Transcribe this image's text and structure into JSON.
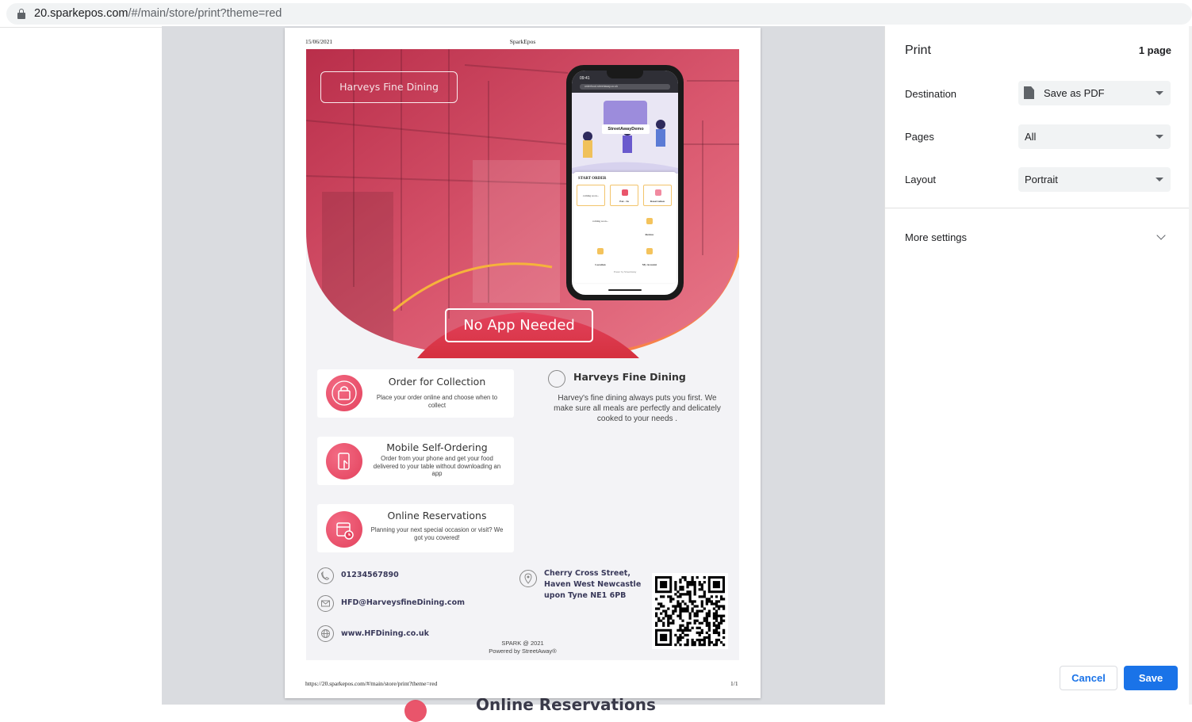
{
  "browser": {
    "url_host": "20.sparkepos.com",
    "url_path": "/#/main/store/print?theme=red"
  },
  "page_header": {
    "date": "15/06/2021",
    "site": "SparkEpos"
  },
  "page_footer": {
    "url": "https://20.sparkepos.com/#/main/store/print?theme=red",
    "page_count": "1/1"
  },
  "flyer": {
    "brand": "Harveys Fine Dining",
    "tagline": "No App Needed",
    "phone_screen": {
      "time": "09:41",
      "address": "orderfood.streetaway.co.uk",
      "store_label": "StreetAwayDemo",
      "start_order": "START ORDER",
      "tiles": [
        "coming soon...",
        "Eat - In",
        "Reservation"
      ],
      "grid": [
        "coming soon...",
        "Review",
        "Location",
        "My Account"
      ],
      "powered": "Power by StreetAway"
    },
    "features": [
      {
        "title": "Order for Collection",
        "desc": "Place your order online and choose when to collect"
      },
      {
        "title": "Mobile Self-Ordering",
        "desc": "Order from your phone and get your food delivered to your table without downloading an app"
      },
      {
        "title": "Online Reservations",
        "desc": "Planning your next special occasion or visit? We got you covered!"
      }
    ],
    "restaurant": {
      "name": "Harveys Fine Dining",
      "description": "Harvey's fine dining always puts you first. We make sure all meals are perfectly and delicately cooked to your needs ."
    },
    "contacts": {
      "phone": "01234567890",
      "email": "HFD@HarveysfineDining.com",
      "website": "www.HFDining.co.uk"
    },
    "address": [
      "Cherry Cross Street,",
      "Haven West Newcastle",
      "upon Tyne NE1 6PB"
    ],
    "footer_line1": "SPARK @ 2021",
    "footer_line2": "Powered by StreetAway®"
  },
  "ghost_text": "Online Reservations",
  "print_panel": {
    "title": "Print",
    "page_count": "1 page",
    "destination_label": "Destination",
    "destination_value": "Save as PDF",
    "pages_label": "Pages",
    "pages_value": "All",
    "layout_label": "Layout",
    "layout_value": "Portrait",
    "more_settings": "More settings",
    "cancel": "Cancel",
    "save": "Save"
  },
  "colors": {
    "accent_red": "#e3425d",
    "orange": "#f7814a",
    "print_blue": "#1a73e8"
  }
}
